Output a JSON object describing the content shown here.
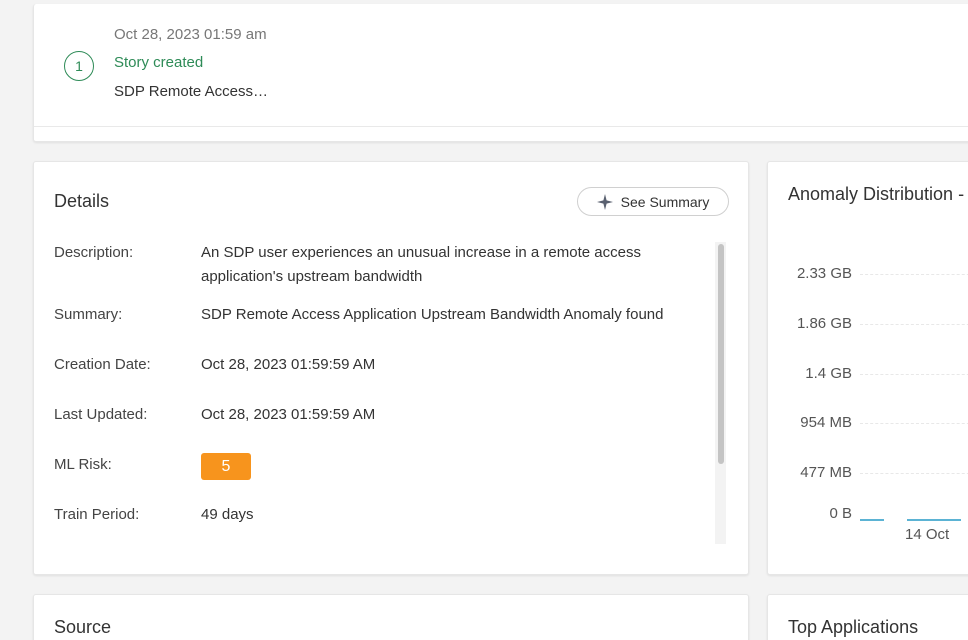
{
  "timeline": {
    "step_number": "1",
    "date": "Oct 28, 2023 01:59 am",
    "status": "Story created",
    "title": "SDP Remote Access…"
  },
  "details": {
    "title": "Details",
    "see_summary_label": "See Summary",
    "rows": {
      "description": {
        "label": "Description:",
        "line1": "An SDP user experiences an unusual increase in a remote access",
        "line2": "application's upstream bandwidth"
      },
      "summary": {
        "label": "Summary:",
        "value": "SDP Remote Access Application Upstream Bandwidth Anomaly found"
      },
      "creation_date": {
        "label": "Creation Date:",
        "value": "Oct 28, 2023 01:59:59 AM"
      },
      "last_updated": {
        "label": "Last Updated:",
        "value": "Oct 28, 2023 01:59:59 AM"
      },
      "ml_risk": {
        "label": "ML Risk:",
        "value": "5"
      },
      "train_period": {
        "label": "Train Period:",
        "value": "49 days"
      }
    }
  },
  "anomaly": {
    "title": "Anomaly Distribution -",
    "yticks": [
      "2.33 GB",
      "1.86 GB",
      "1.4 GB",
      "954 MB",
      "477 MB",
      "0 B"
    ],
    "xtick": "14 Oct"
  },
  "source": {
    "title": "Source"
  },
  "top_applications": {
    "title": "Top Applications"
  },
  "colors": {
    "accent_green": "#2e8b57",
    "risk_orange": "#f7941d",
    "series_blue": "#5bb3d4"
  }
}
